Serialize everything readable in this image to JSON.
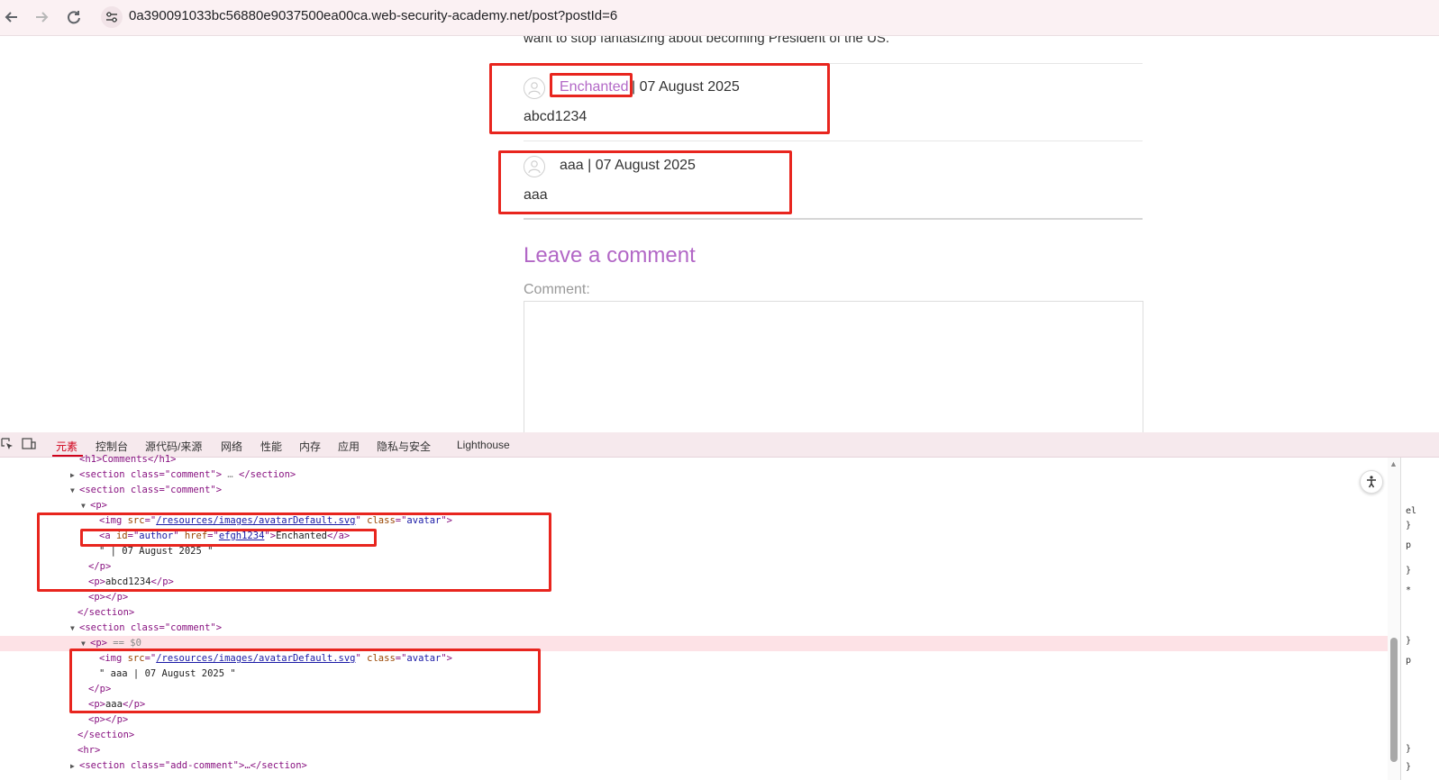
{
  "browser": {
    "url": "0a390091033bc56880e9037500ea00ca.web-security-academy.net/post?postId=6",
    "back_icon": "arrow-left-icon",
    "forward_icon": "arrow-right-icon",
    "reload_icon": "reload-icon",
    "site_info_icon": "tune-icon"
  },
  "page": {
    "intro_text": "want to stop fantasizing about becoming President of the US.",
    "comments": [
      {
        "author": "Enchanted",
        "is_link": true,
        "date_sep": " | 07 August 2025",
        "body": "abcd1234"
      },
      {
        "author_line": "aaa | 07 August 2025",
        "body": "aaa"
      }
    ],
    "leave_comment_heading": "Leave a comment",
    "comment_label": "Comment:"
  },
  "devtools": {
    "tabs": [
      "元素",
      "控制台",
      "源代码/来源",
      "网络",
      "性能",
      "内存",
      "应用",
      "隐私与安全",
      "Lighthouse"
    ],
    "active_tab": "元素",
    "lines": {
      "l0": "<h1>Comments</h1>",
      "l1a": "<section class=\"comment\">",
      "l1b": "…",
      "l1c": "</section>",
      "l2": "<section class=\"comment\">",
      "l3": "<p>",
      "l4_src": "/resources/images/avatarDefault.svg",
      "l4_class": "avatar",
      "l5_id": "author",
      "l5_href": "efgh1234",
      "l5_text": "Enchanted",
      "l6": "\" | 07 August 2025 \"",
      "l7": "</p>",
      "l8_text": "abcd1234",
      "l9": "<p></p>",
      "l10": "</section>",
      "l11": "<section class=\"comment\">",
      "l12_eq": "== $0",
      "l13_src": "/resources/images/avatarDefault.svg",
      "l13_class": "avatar",
      "l14": "\" aaa | 07 August 2025 \"",
      "l15": "</p>",
      "l16_text": "aaa",
      "l17": "<p></p>",
      "l18": "</section>",
      "l19": "<hr>",
      "l20": "<section class=\"add-comment\">…</section>"
    },
    "right_pane_chars": [
      "el",
      "}",
      "p",
      "}",
      "*",
      "}",
      "p",
      "}",
      "}"
    ]
  },
  "colors": {
    "accent": "#b267c6",
    "highlight_box": "#e8251e",
    "devtools_active": "#d0021b"
  }
}
